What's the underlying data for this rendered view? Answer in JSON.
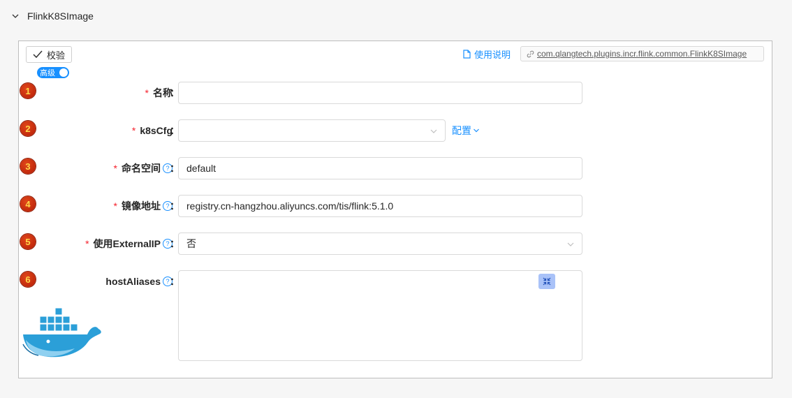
{
  "section": {
    "title": "FlinkK8SImage",
    "collapse_icon": "chevron-down-icon"
  },
  "toolbar": {
    "verify_label": "校验",
    "advanced_toggle_label": "高级",
    "advanced_on": true,
    "doc_link_label": "使用说明",
    "plugin_class": "com.qlangtech.plugins.incr.flink.common.FlinkK8SImage"
  },
  "form": {
    "colon": "：",
    "rows": [
      {
        "index": "1",
        "label": "名称",
        "required": true,
        "help": false,
        "type": "input",
        "value": ""
      },
      {
        "index": "2",
        "label": "k8sCfg",
        "required": true,
        "help": false,
        "type": "select",
        "value": "",
        "extra_link": "配置"
      },
      {
        "index": "3",
        "label": "命名空间",
        "required": true,
        "help": true,
        "type": "input",
        "value": "default"
      },
      {
        "index": "4",
        "label": "镜像地址",
        "required": true,
        "help": true,
        "type": "input",
        "value": "registry.cn-hangzhou.aliyuncs.com/tis/flink:5.1.0"
      },
      {
        "index": "5",
        "label": "使用ExternalIP",
        "required": true,
        "help": true,
        "type": "select",
        "value": "否"
      },
      {
        "index": "6",
        "label": "hostAliases",
        "required": false,
        "help": true,
        "type": "textarea",
        "value": ""
      }
    ]
  },
  "colors": {
    "accent": "#1890ff",
    "required": "#f5222d",
    "badge": "#c8260b"
  }
}
